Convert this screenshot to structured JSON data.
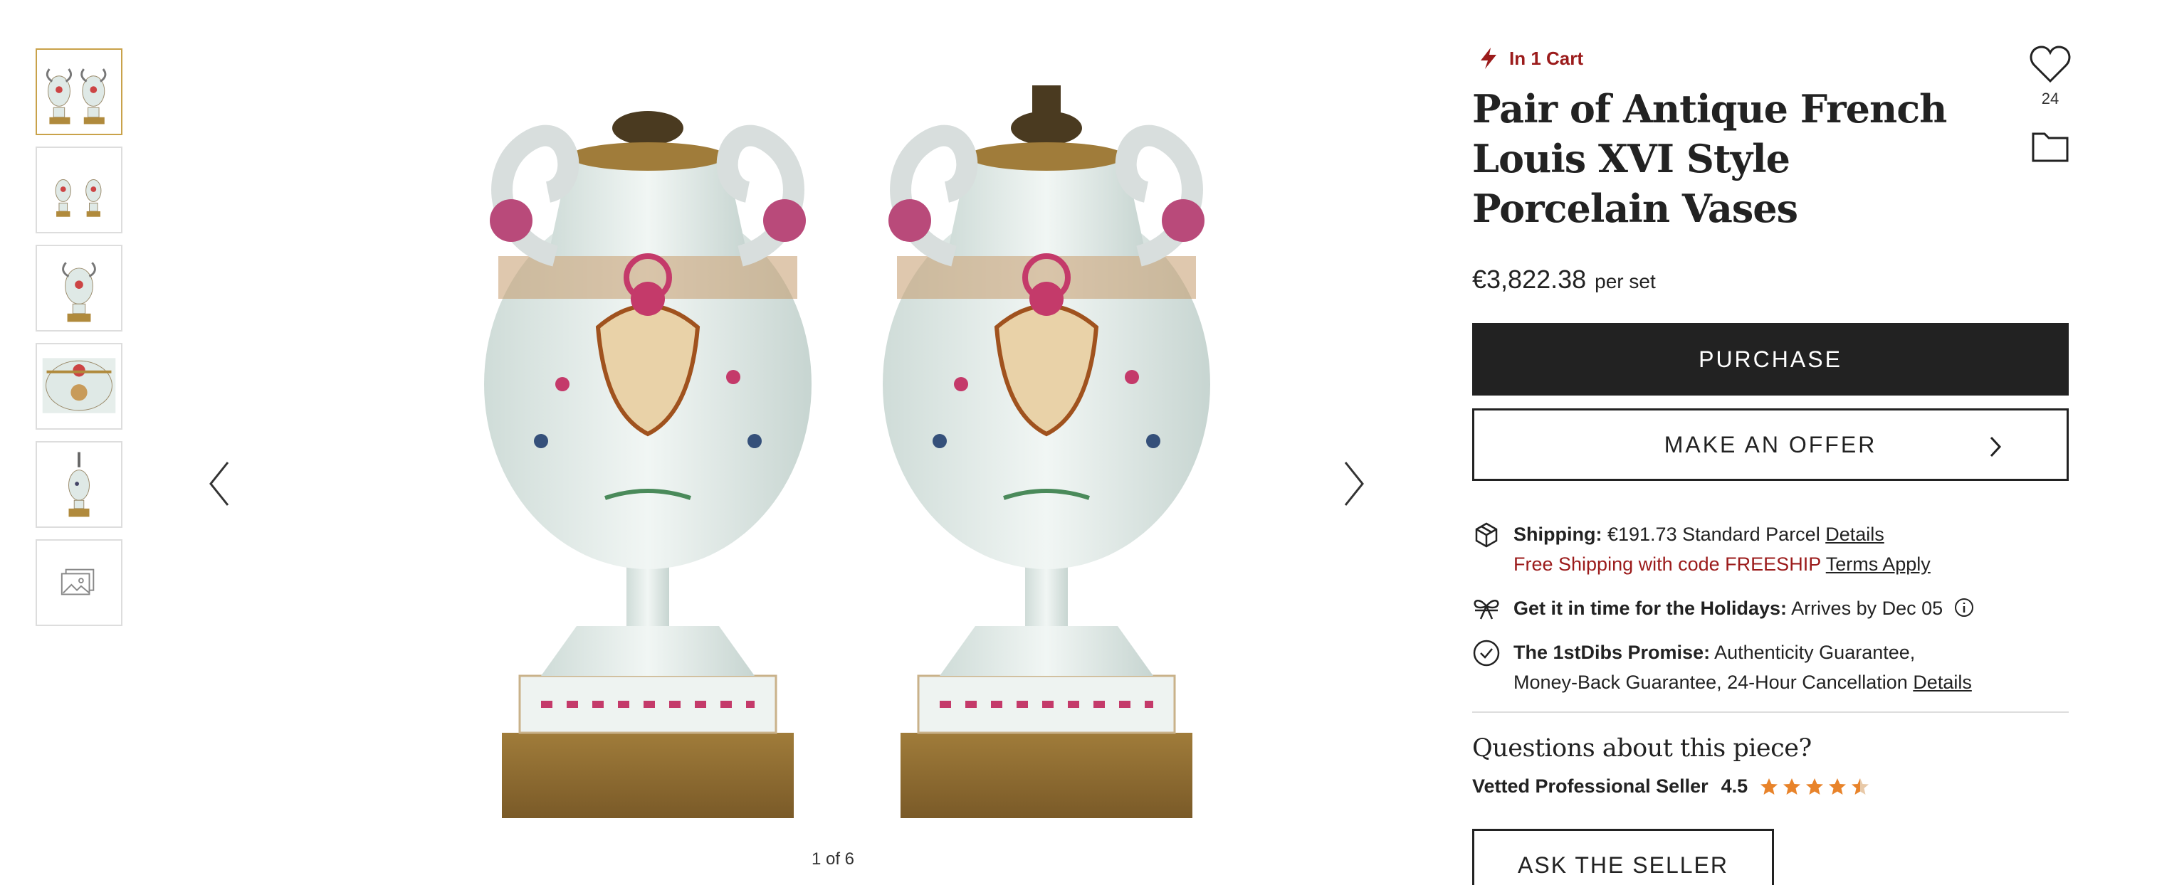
{
  "thumbnails": [
    {
      "label": "pair-front",
      "active": true
    },
    {
      "label": "pair-small",
      "active": false
    },
    {
      "label": "single-front",
      "active": false
    },
    {
      "label": "top-detail",
      "active": false
    },
    {
      "label": "single-side",
      "active": false
    },
    {
      "label": "more-images",
      "active": false
    }
  ],
  "gallery": {
    "counter": "1 of 6"
  },
  "product": {
    "cart_status": "In 1 Cart",
    "title": "Pair of Antique French Louis XVI Style Porcelain Vases",
    "price": "€3,822.38",
    "price_unit": "per set",
    "favorite_count": "24"
  },
  "buttons": {
    "purchase": "PURCHASE",
    "offer": "MAKE AN OFFER",
    "ask": "ASK THE SELLER"
  },
  "shipping": {
    "label": "Shipping:",
    "value": "€191.73 Standard Parcel",
    "details": "Details",
    "promo": "Free Shipping with code FREESHIP",
    "terms": "Terms Apply"
  },
  "holiday": {
    "label": "Get it in time for the Holidays:",
    "value": "Arrives by Dec 05"
  },
  "promise": {
    "label": "The 1stDibs Promise:",
    "line1": "Authenticity Guarantee,",
    "line2": "Money-Back Guarantee, 24-Hour Cancellation",
    "details": "Details"
  },
  "seller": {
    "questions": "Questions about this piece?",
    "label": "Vetted Professional Seller",
    "rating": "4.5",
    "stars": 4.5
  },
  "colors": {
    "accent_red": "#9b1b1b",
    "star": "#e8832a",
    "dark": "#222222"
  }
}
